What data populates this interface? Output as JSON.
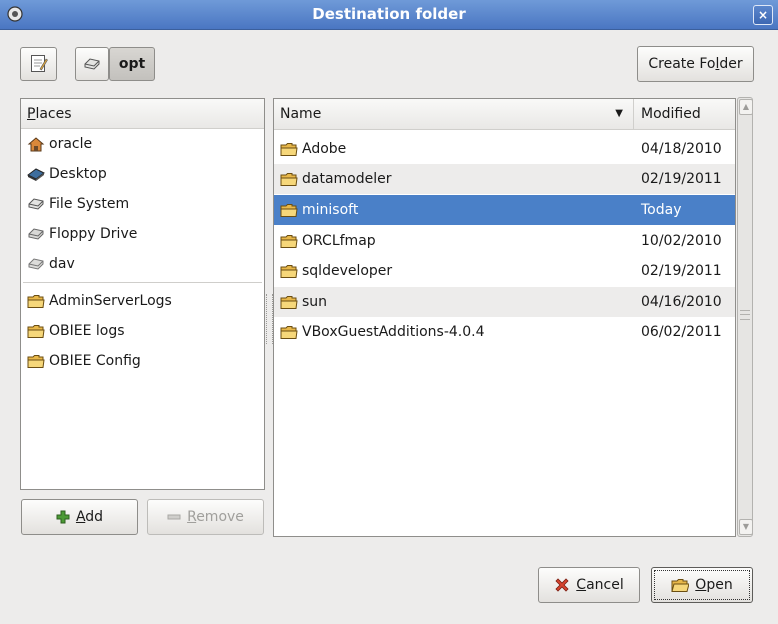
{
  "window": {
    "title": "Destination folder",
    "close_glyph": "×"
  },
  "pathbar": {
    "current": "opt"
  },
  "toolbar": {
    "create_folder_label": "Create Folder",
    "create_folder_prefix": "Create Fo",
    "create_folder_mnemonic": "l",
    "create_folder_suffix": "der"
  },
  "places": {
    "header_mnemonic": "P",
    "header_rest": "laces",
    "items": [
      {
        "label": "oracle",
        "icon": "home-icon"
      },
      {
        "label": "Desktop",
        "icon": "desktop-icon"
      },
      {
        "label": "File System",
        "icon": "drive-icon"
      },
      {
        "label": "Floppy Drive",
        "icon": "floppy-icon"
      },
      {
        "label": "dav",
        "icon": "drive-icon"
      }
    ],
    "bookmarks": [
      {
        "label": "AdminServerLogs",
        "icon": "folder-icon"
      },
      {
        "label": "OBIEE logs",
        "icon": "folder-icon"
      },
      {
        "label": "OBIEE Config",
        "icon": "folder-icon"
      }
    ],
    "add_mnemonic": "A",
    "add_rest": "dd",
    "remove_mnemonic": "R",
    "remove_rest": "emove"
  },
  "files": {
    "col_name": "Name",
    "col_modified": "Modified",
    "rows": [
      {
        "name": "Adobe",
        "modified": "04/18/2010"
      },
      {
        "name": "datamodeler",
        "modified": "02/19/2011"
      },
      {
        "name": "minisoft",
        "modified": "Today"
      },
      {
        "name": "ORCLfmap",
        "modified": "10/02/2010"
      },
      {
        "name": "sqldeveloper",
        "modified": "02/19/2011"
      },
      {
        "name": "sun",
        "modified": "04/16/2010"
      },
      {
        "name": "VBoxGuestAdditions-4.0.4",
        "modified": "06/02/2011"
      }
    ]
  },
  "footer": {
    "cancel_mnemonic": "C",
    "cancel_rest": "ancel",
    "open_mnemonic": "O",
    "open_rest": "pen"
  },
  "colors": {
    "titlebar": "#4a76c2",
    "selection": "#4a80c8",
    "dialog_bg": "#edeceb"
  }
}
